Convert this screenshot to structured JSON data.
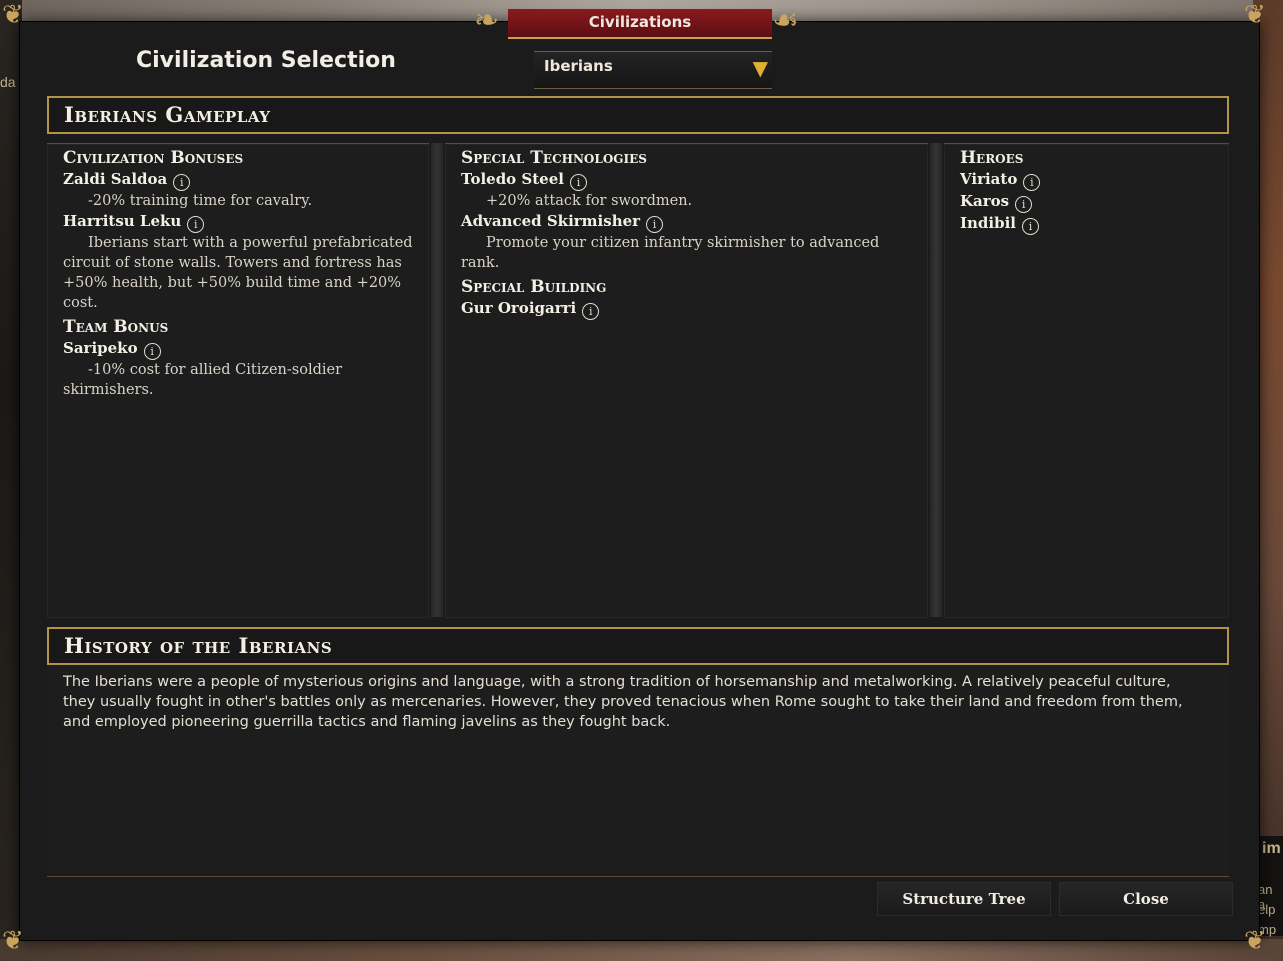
{
  "window": {
    "title": "Civilizations"
  },
  "selection": {
    "label": "Civilization Selection",
    "selected": "Iberians"
  },
  "gameplay": {
    "heading": "Iberians Gameplay",
    "bonuses": {
      "title": "Civilization Bonuses",
      "items": [
        {
          "name": "Zaldi Saldoa",
          "desc": "-20% training time for cavalry."
        },
        {
          "name": "Harritsu Leku",
          "desc": "Iberians start with a powerful prefabricated circuit of stone walls. Towers and fortress has +50% health, but +50% build time and +20% cost."
        }
      ]
    },
    "team_bonus": {
      "title": "Team Bonus",
      "items": [
        {
          "name": "Saripeko",
          "desc": "-10% cost for allied Citizen-soldier skirmishers."
        }
      ]
    },
    "technologies": {
      "title": "Special Technologies",
      "items": [
        {
          "name": "Toledo Steel",
          "desc": "+20% attack for swordmen."
        },
        {
          "name": "Advanced Skirmisher",
          "desc": "Promote your citizen infantry skirmisher to advanced rank."
        }
      ]
    },
    "building": {
      "title": "Special Building",
      "items": [
        {
          "name": "Gur Oroigarri"
        }
      ]
    },
    "heroes": {
      "title": "Heroes",
      "items": [
        {
          "name": "Viriato"
        },
        {
          "name": "Karos"
        },
        {
          "name": "Indibil"
        }
      ]
    }
  },
  "history": {
    "heading": "History of the Iberians",
    "text": "The Iberians were a people of mysterious origins and language, with a strong tradition of horsemanship and metalworking. A relatively peaceful culture, they usually fought in other's battles only as mercenaries. However, they proved tenacious when Rome sought to take their land and freedom from them, and employed pioneering guerrilla tactics and flaming javelins as they fought back."
  },
  "buttons": {
    "structure_tree": "Structure Tree",
    "close": "Close"
  },
  "background": {
    "left_fragment": "da",
    "right_fragment": "im",
    "right_lines": [
      "an a",
      "elp",
      "mp"
    ]
  },
  "icons": {
    "info": "info-icon",
    "dropdown": "dropdown-arrow-icon"
  },
  "colors": {
    "accent_gold": "#b39446",
    "title_red": "#7a1418",
    "panel": "#1d1d1d"
  }
}
